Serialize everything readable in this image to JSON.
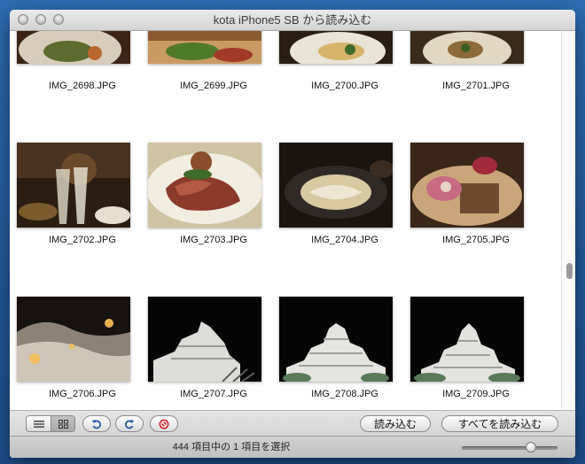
{
  "window": {
    "title": "kota iPhone5 SB から読み込む"
  },
  "photos": [
    {
      "name": "IMG_2698.JPG"
    },
    {
      "name": "IMG_2699.JPG"
    },
    {
      "name": "IMG_2700.JPG"
    },
    {
      "name": "IMG_2701.JPG"
    },
    {
      "name": "IMG_2702.JPG"
    },
    {
      "name": "IMG_2703.JPG"
    },
    {
      "name": "IMG_2704.JPG"
    },
    {
      "name": "IMG_2705.JPG"
    },
    {
      "name": "IMG_2706.JPG"
    },
    {
      "name": "IMG_2707.JPG"
    },
    {
      "name": "IMG_2708.JPG"
    },
    {
      "name": "IMG_2709.JPG"
    }
  ],
  "toolbar": {
    "import_label": "読み込む",
    "import_all_label": "すべてを読み込む",
    "icons": [
      "list-view-icon",
      "icon-view-icon",
      "rotate-left-icon",
      "rotate-right-icon",
      "delete-icon"
    ],
    "active_view": "icon-view"
  },
  "status": {
    "text": "444 項目中の 1 項目を選択"
  },
  "zoom": {
    "level": 0.75
  },
  "scroll": {
    "position": 0.62
  }
}
